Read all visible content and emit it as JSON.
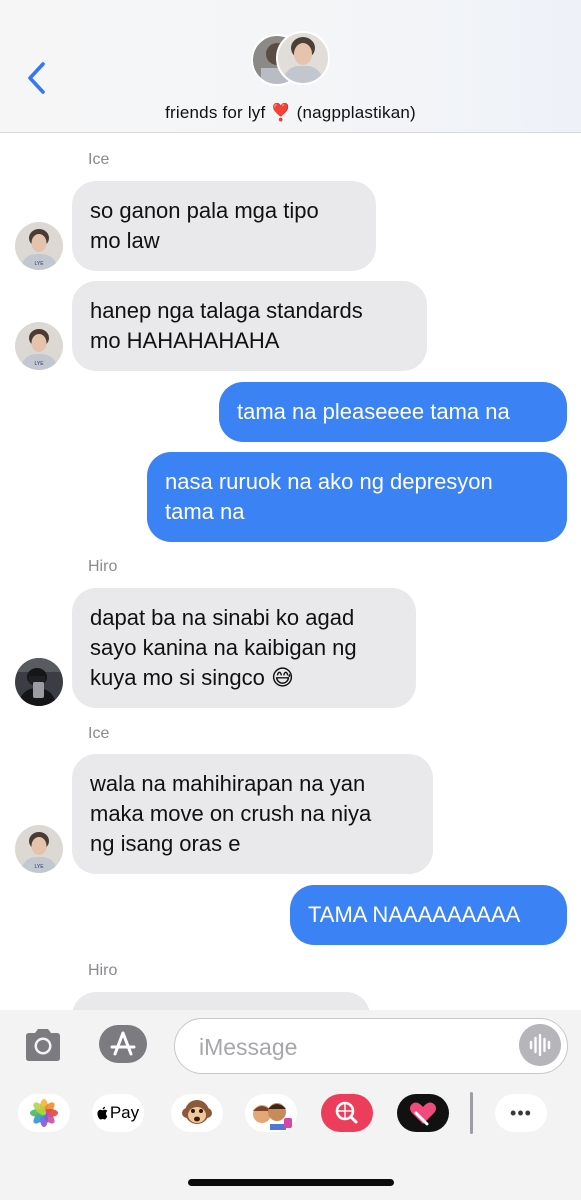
{
  "header": {
    "title": "friends for lyf ❣️ (nagpplastikan)",
    "back_icon": "chevron-left-icon"
  },
  "messages": [
    {
      "sender": "Ice",
      "direction": "in",
      "text": "so ganon pala mga tipo\nmo law"
    },
    {
      "sender": "",
      "direction": "in",
      "text": "hanep nga talaga standards\nmo HAHAHAHAHA"
    },
    {
      "sender": "",
      "direction": "out",
      "text": "tama na pleaseeee tama na"
    },
    {
      "sender": "",
      "direction": "out",
      "text": "nasa ruruok na ako ng depresyon\ntama na"
    },
    {
      "sender": "Hiro",
      "direction": "in",
      "text": "dapat ba na sinabi ko agad\nsayo kanina na kaibigan ng\nkuya mo si singco 😅"
    },
    {
      "sender": "Ice",
      "direction": "in",
      "text": "wala na mahihirapan na yan\nmaka move on crush na niya\nng isang oras e"
    },
    {
      "sender": "",
      "direction": "out",
      "text": "TAMA NAAAAAAAAA"
    },
    {
      "sender": "Hiro",
      "direction": "in",
      "text": ""
    }
  ],
  "input": {
    "placeholder": "iMessage",
    "value": ""
  },
  "app_drawer": {
    "items": [
      "photos-icon",
      "apple-pay-icon",
      "animoji-icon",
      "memoji-icon",
      "image-search-icon",
      "digital-touch-icon",
      "more-icon"
    ],
    "apple_pay_label": "Pay",
    "more_label": "•••"
  },
  "colors": {
    "outgoing_bubble": "#3b82f4",
    "incoming_bubble": "#e9e9eb",
    "accent": "#3478f6"
  }
}
